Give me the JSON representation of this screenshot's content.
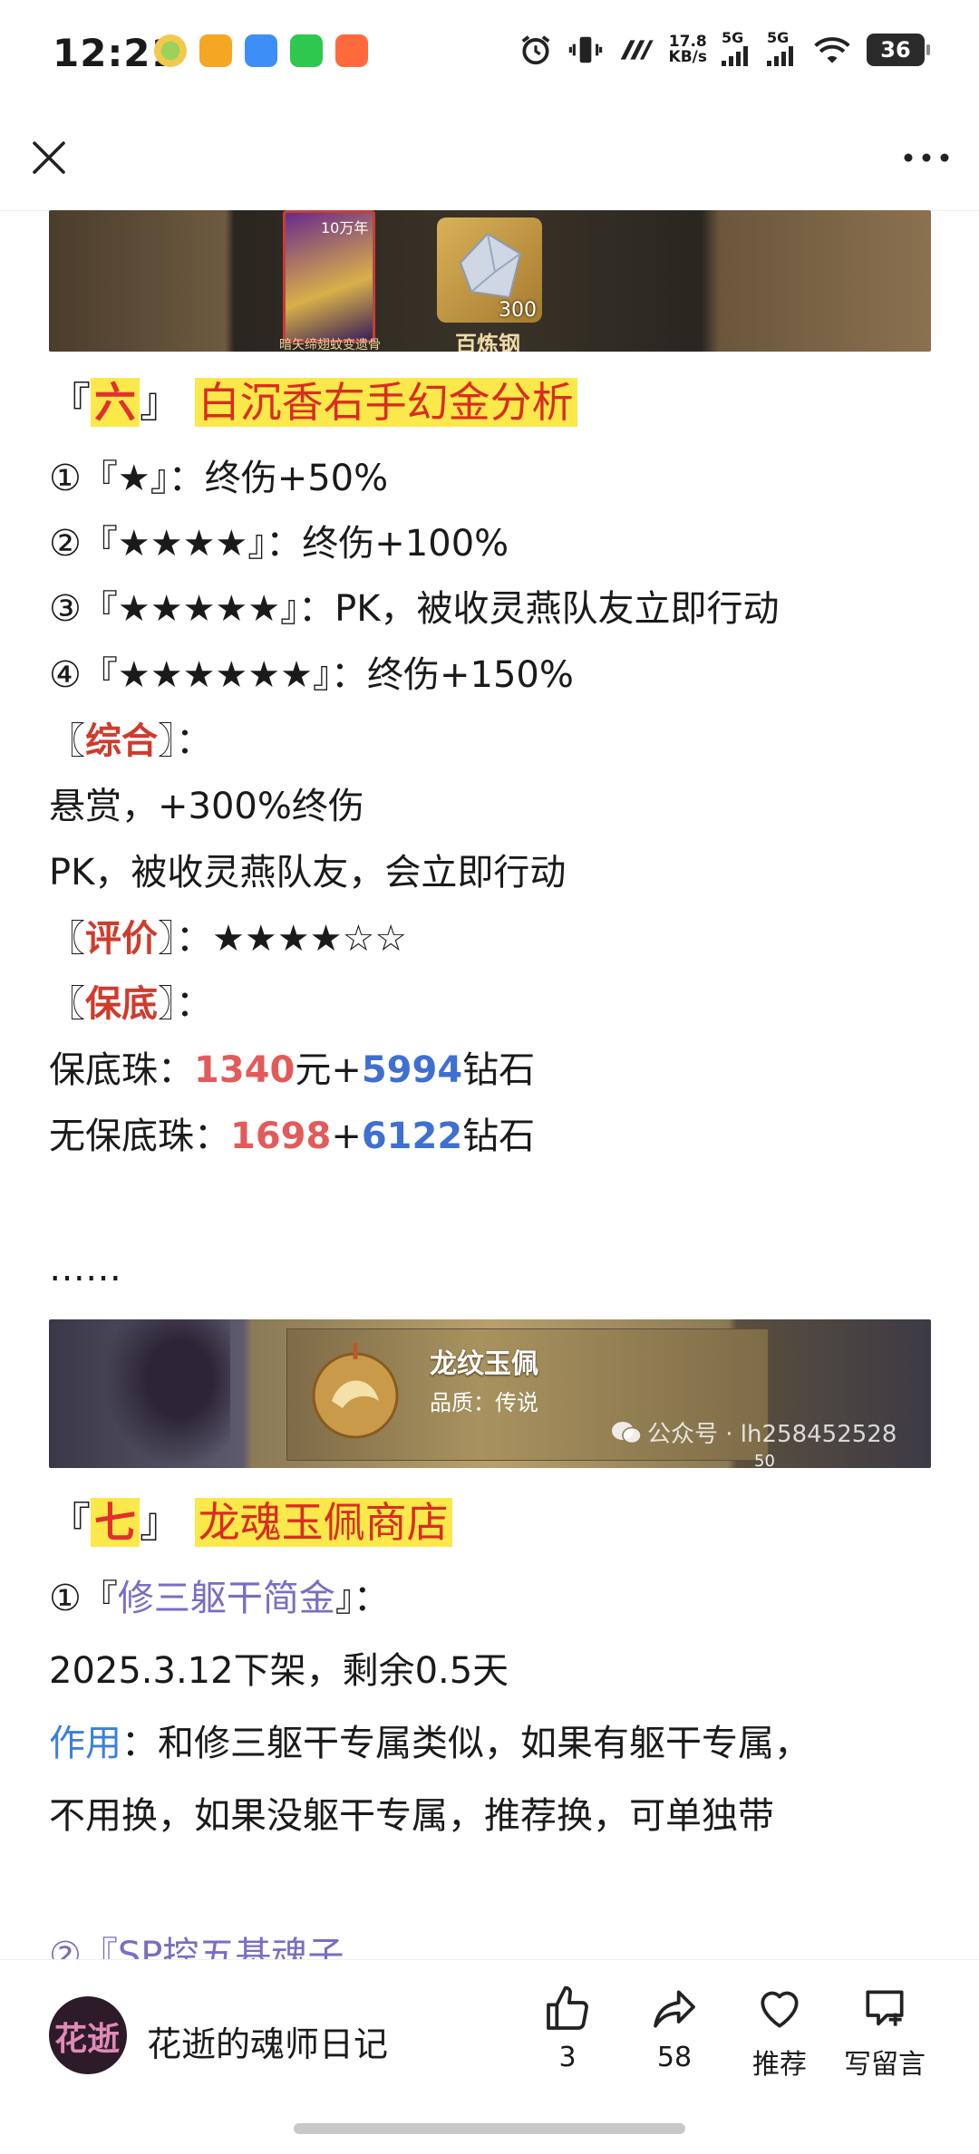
{
  "status_bar": {
    "time": "12:21",
    "net_speed_value": "17.8",
    "net_speed_unit": "KB/s",
    "signal1": "5G",
    "signal2": "5G",
    "battery": "36"
  },
  "nav": {
    "close_icon": "close-icon",
    "more_icon": "more-icon"
  },
  "article": {
    "banner_top_labels": {
      "badge": "10万年",
      "item_count": "300",
      "item_name": "百炼钢",
      "card_caption": "暗矢缔翅蚊变遗骨"
    },
    "section6": {
      "open": "『",
      "num": "六",
      "close": "』",
      "title": "白沉香右手幻金分析"
    },
    "s6_items": [
      "①『★』：终伤+50%",
      "②『★★★★』：终伤+100%",
      "③『★★★★★』：PK，被收灵燕队友立即行动",
      "④『★★★★★★』：终伤+150%"
    ],
    "summary_label": "综合",
    "summary_lines": [
      "悬赏，+300%终伤",
      "PK，被收灵燕队友，会立即行动"
    ],
    "rating_label": "评价",
    "rating_value": "★★★★☆☆",
    "guarantee_label": "保底",
    "guarantee_line1": {
      "prefix": "保底珠：",
      "amount": "1340",
      "mid": "元+",
      "diamonds": "5994",
      "suffix": "钻石"
    },
    "guarantee_line2": {
      "prefix": "无保底珠：",
      "amount": "1698",
      "mid": "+",
      "diamonds": "6122",
      "suffix": "钻石"
    },
    "ellipsis": "……",
    "banner_mid": {
      "item_title": "龙纹玉佩",
      "item_quality": "品质：传说",
      "watermark": "公众号 · lh258452528",
      "count": "50"
    },
    "section7": {
      "open": "『",
      "num": "七",
      "close": "』",
      "title": "龙魂玉佩商店"
    },
    "s7_item1": {
      "prefix": "①『",
      "name": "修三躯干简金",
      "suffix": "』："
    },
    "s7_date": "2025.3.12下架，剩余0.5天",
    "s7_effect_label": "作用",
    "s7_effect_text": "：和修三躯干专属类似，如果有躯干专属，",
    "s7_effect_text2": "不用换，如果没躯干专属，推荐换，可单独带",
    "s7_item2_partial": "②『SP控五基魂子"
  },
  "bottom_bar": {
    "author": "花逝的魂师日记",
    "avatar_text": "花逝",
    "like_count": "3",
    "share_count": "58",
    "recommend_label": "推荐",
    "comment_label": "写留言"
  }
}
